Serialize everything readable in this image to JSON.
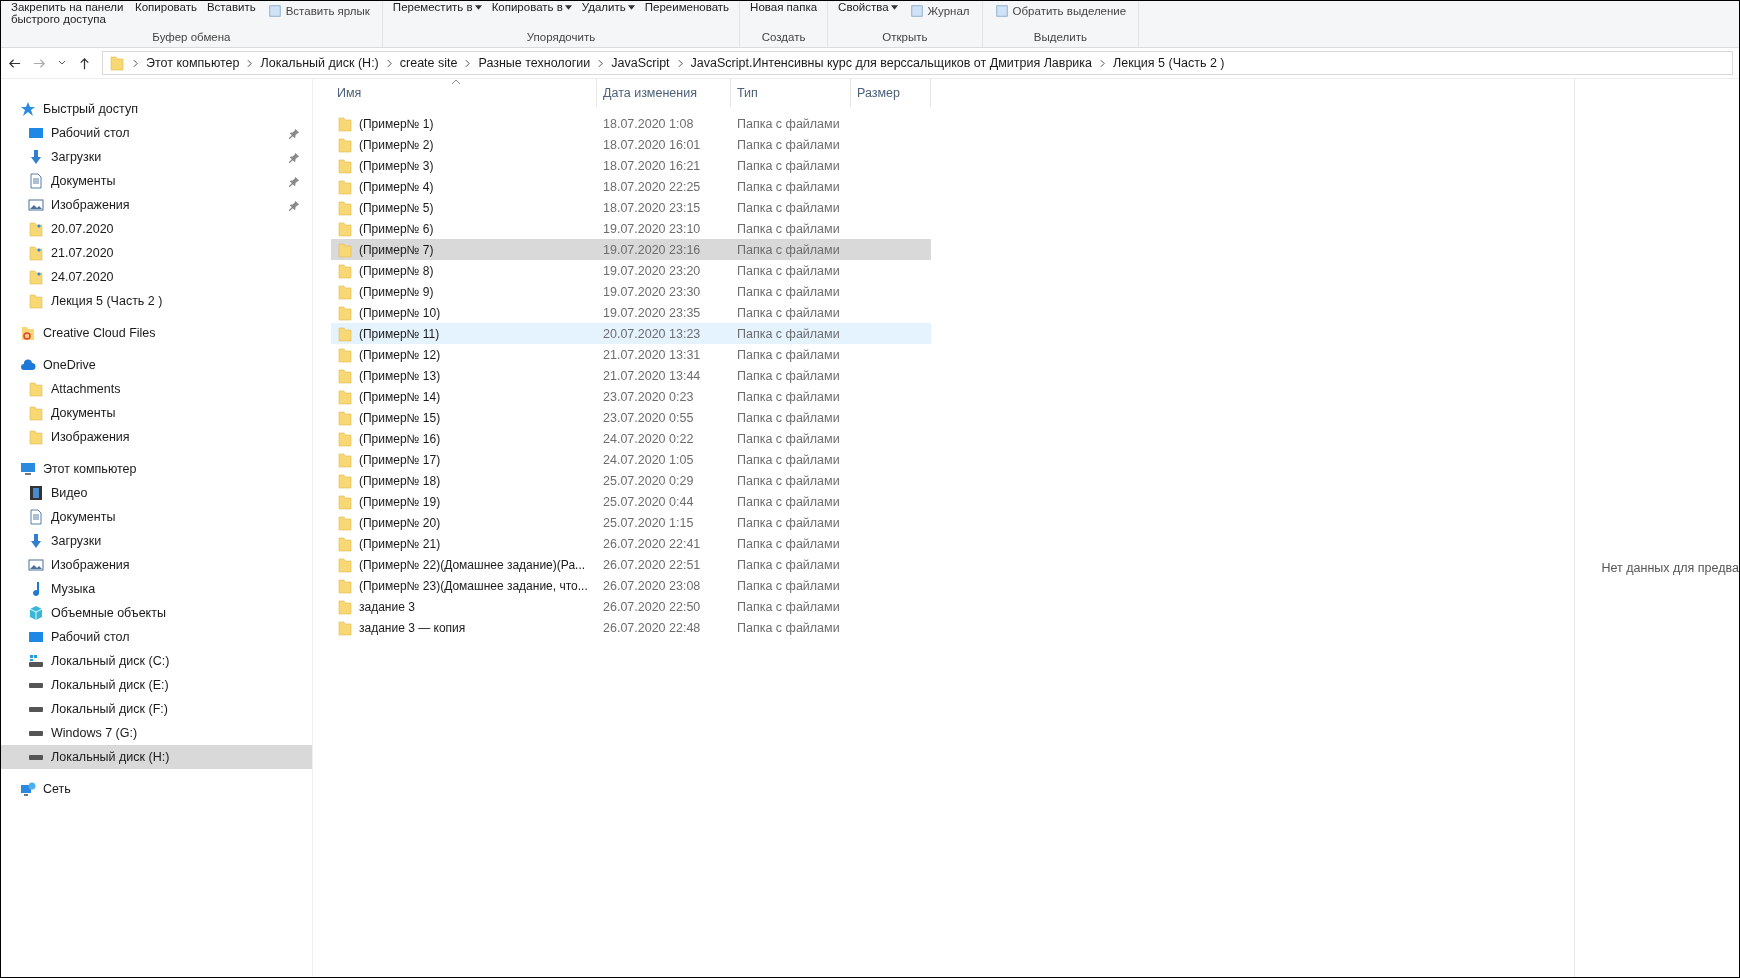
{
  "ribbon": {
    "groups": [
      {
        "label": "Буфер обмена",
        "items": [
          {
            "kind": "large",
            "label": "Закрепить на панели быстрого доступа",
            "dropdown": false
          },
          {
            "kind": "large",
            "label": "Копировать",
            "dropdown": false
          },
          {
            "kind": "large",
            "label": "Вставить",
            "dropdown": false
          },
          {
            "kind": "small",
            "label": "Вставить ярлык",
            "dropdown": false
          }
        ]
      },
      {
        "label": "Упорядочить",
        "items": [
          {
            "kind": "large",
            "label": "Переместить в",
            "dropdown": true
          },
          {
            "kind": "large",
            "label": "Копировать в",
            "dropdown": true
          },
          {
            "kind": "large",
            "label": "Удалить",
            "dropdown": true
          },
          {
            "kind": "large",
            "label": "Переименовать",
            "dropdown": false
          }
        ]
      },
      {
        "label": "Создать",
        "items": [
          {
            "kind": "large",
            "label": "Новая папка",
            "dropdown": false
          }
        ]
      },
      {
        "label": "Открыть",
        "items": [
          {
            "kind": "large",
            "label": "Свойства",
            "dropdown": true
          },
          {
            "kind": "small",
            "label": "Журнал",
            "dropdown": false
          }
        ]
      },
      {
        "label": "Выделить",
        "items": [
          {
            "kind": "small",
            "label": "Обратить выделение",
            "dropdown": false
          }
        ]
      }
    ]
  },
  "address": {
    "crumbs": [
      "Этот компьютер",
      "Локальный диск (H:)",
      "create site",
      "Разные технологии",
      "JavaScript",
      "JavaScript.Интенсивны курс для верссальщиков от Дмитрия Лаврика",
      "Лекция 5 (Часть 2 )"
    ]
  },
  "sidebar": {
    "sections": [
      {
        "label": "Быстрый доступ",
        "kind": "star",
        "selected": false,
        "children": [
          {
            "label": "Рабочий стол",
            "kind": "desktop",
            "pinned": true,
            "selected": false
          },
          {
            "label": "Загрузки",
            "kind": "downloads",
            "pinned": true,
            "selected": false
          },
          {
            "label": "Документы",
            "kind": "documents",
            "pinned": true,
            "selected": false
          },
          {
            "label": "Изображения",
            "kind": "pictures",
            "pinned": true,
            "selected": false
          },
          {
            "label": "20.07.2020",
            "kind": "recent-folder",
            "pinned": false,
            "selected": false
          },
          {
            "label": "21.07.2020",
            "kind": "recent-folder",
            "pinned": false,
            "selected": false
          },
          {
            "label": "24.07.2020",
            "kind": "recent-folder",
            "pinned": false,
            "selected": false
          },
          {
            "label": "Лекция 5 (Часть 2 )",
            "kind": "folder",
            "pinned": false,
            "selected": false
          }
        ]
      },
      {
        "label": "Creative Cloud Files",
        "kind": "cc",
        "selected": false
      },
      {
        "label": "OneDrive",
        "kind": "cloud",
        "selected": false,
        "children": [
          {
            "label": "Attachments",
            "kind": "folder",
            "pinned": false,
            "selected": false
          },
          {
            "label": "Документы",
            "kind": "folder",
            "pinned": false,
            "selected": false
          },
          {
            "label": "Изображения",
            "kind": "folder",
            "pinned": false,
            "selected": false
          }
        ]
      },
      {
        "label": "Этот компьютер",
        "kind": "computer",
        "selected": false,
        "children": [
          {
            "label": "Видео",
            "kind": "video",
            "pinned": false,
            "selected": false
          },
          {
            "label": "Документы",
            "kind": "documents",
            "pinned": false,
            "selected": false
          },
          {
            "label": "Загрузки",
            "kind": "downloads",
            "pinned": false,
            "selected": false
          },
          {
            "label": "Изображения",
            "kind": "pictures",
            "pinned": false,
            "selected": false
          },
          {
            "label": "Музыка",
            "kind": "music",
            "pinned": false,
            "selected": false
          },
          {
            "label": "Объемные объекты",
            "kind": "objects",
            "pinned": false,
            "selected": false
          },
          {
            "label": "Рабочий стол",
            "kind": "desktop",
            "pinned": false,
            "selected": false
          },
          {
            "label": "Локальный диск (C:)",
            "kind": "system-drive",
            "pinned": false,
            "selected": false
          },
          {
            "label": "Локальный диск (E:)",
            "kind": "drive",
            "pinned": false,
            "selected": false
          },
          {
            "label": "Локальный диск (F:)",
            "kind": "drive",
            "pinned": false,
            "selected": false
          },
          {
            "label": "Windows 7 (G:)",
            "kind": "drive",
            "pinned": false,
            "selected": false
          },
          {
            "label": "Локальный диск (H:)",
            "kind": "drive",
            "pinned": false,
            "selected": true
          }
        ]
      },
      {
        "label": "Сеть",
        "kind": "network",
        "selected": false
      }
    ]
  },
  "table": {
    "columns": [
      "Имя",
      "Дата изменения",
      "Тип",
      "Размер"
    ],
    "rows": [
      {
        "name": "(Пример№ 1)",
        "date": "18.07.2020 1:08",
        "type": "Папка с файлами",
        "selected": false,
        "hovered": false
      },
      {
        "name": "(Пример№ 2)",
        "date": "18.07.2020 16:01",
        "type": "Папка с файлами",
        "selected": false,
        "hovered": false
      },
      {
        "name": "(Пример№ 3)",
        "date": "18.07.2020 16:21",
        "type": "Папка с файлами",
        "selected": false,
        "hovered": false
      },
      {
        "name": "(Пример№ 4)",
        "date": "18.07.2020 22:25",
        "type": "Папка с файлами",
        "selected": false,
        "hovered": false
      },
      {
        "name": "(Пример№ 5)",
        "date": "18.07.2020 23:15",
        "type": "Папка с файлами",
        "selected": false,
        "hovered": false
      },
      {
        "name": "(Пример№ 6)",
        "date": "19.07.2020 23:10",
        "type": "Папка с файлами",
        "selected": false,
        "hovered": false
      },
      {
        "name": "(Пример№ 7)",
        "date": "19.07.2020 23:16",
        "type": "Папка с файлами",
        "selected": true,
        "hovered": false
      },
      {
        "name": "(Пример№ 8)",
        "date": "19.07.2020 23:20",
        "type": "Папка с файлами",
        "selected": false,
        "hovered": false
      },
      {
        "name": "(Пример№ 9)",
        "date": "19.07.2020 23:30",
        "type": "Папка с файлами",
        "selected": false,
        "hovered": false
      },
      {
        "name": "(Пример№ 10)",
        "date": "19.07.2020 23:35",
        "type": "Папка с файлами",
        "selected": false,
        "hovered": false
      },
      {
        "name": "(Пример№ 11)",
        "date": "20.07.2020 13:23",
        "type": "Папка с файлами",
        "selected": false,
        "hovered": true
      },
      {
        "name": "(Пример№ 12)",
        "date": "21.07.2020 13:31",
        "type": "Папка с файлами",
        "selected": false,
        "hovered": false
      },
      {
        "name": "(Пример№ 13)",
        "date": "21.07.2020 13:44",
        "type": "Папка с файлами",
        "selected": false,
        "hovered": false
      },
      {
        "name": "(Пример№ 14)",
        "date": "23.07.2020 0:23",
        "type": "Папка с файлами",
        "selected": false,
        "hovered": false
      },
      {
        "name": "(Пример№ 15)",
        "date": "23.07.2020 0:55",
        "type": "Папка с файлами",
        "selected": false,
        "hovered": false
      },
      {
        "name": "(Пример№ 16)",
        "date": "24.07.2020 0:22",
        "type": "Папка с файлами",
        "selected": false,
        "hovered": false
      },
      {
        "name": "(Пример№ 17)",
        "date": "24.07.2020 1:05",
        "type": "Папка с файлами",
        "selected": false,
        "hovered": false
      },
      {
        "name": "(Пример№ 18)",
        "date": "25.07.2020 0:29",
        "type": "Папка с файлами",
        "selected": false,
        "hovered": false
      },
      {
        "name": "(Пример№ 19)",
        "date": "25.07.2020 0:44",
        "type": "Папка с файлами",
        "selected": false,
        "hovered": false
      },
      {
        "name": "(Пример№ 20)",
        "date": "25.07.2020 1:15",
        "type": "Папка с файлами",
        "selected": false,
        "hovered": false
      },
      {
        "name": "(Пример№ 21)",
        "date": "26.07.2020 22:41",
        "type": "Папка с файлами",
        "selected": false,
        "hovered": false
      },
      {
        "name": "(Пример№ 22)(Домашнее задание)(Ра...",
        "date": "26.07.2020 22:51",
        "type": "Папка с файлами",
        "selected": false,
        "hovered": false
      },
      {
        "name": "(Пример№ 23)(Домашнее задание, что...",
        "date": "26.07.2020 23:08",
        "type": "Папка с файлами",
        "selected": false,
        "hovered": false
      },
      {
        "name": "задание 3",
        "date": "26.07.2020 22:50",
        "type": "Папка с файлами",
        "selected": false,
        "hovered": false
      },
      {
        "name": "задание 3 — копия",
        "date": "26.07.2020 22:48",
        "type": "Папка с файлами",
        "selected": false,
        "hovered": false
      }
    ]
  },
  "preview": {
    "message": "Нет данных для предва"
  }
}
